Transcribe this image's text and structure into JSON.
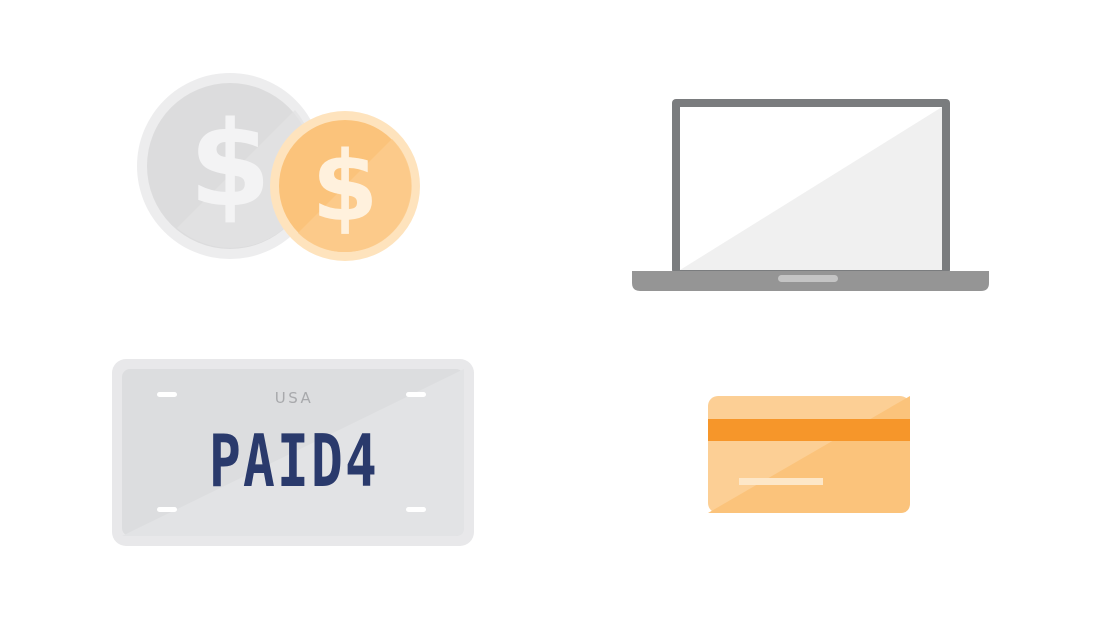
{
  "coins": {
    "silver_symbol": "$",
    "gold_symbol": "$"
  },
  "license_plate": {
    "country": "USA",
    "number": "PAID4"
  },
  "colors": {
    "silver_coin": "#dcdcdd",
    "silver_rim": "#ededee",
    "gold_coin": "#fbc37b",
    "gold_rim": "#fee3bd",
    "laptop_frame": "#7a7c7e",
    "laptop_screen": "#f0f0f0",
    "laptop_base": "#959595",
    "plate_body": "#dcdddf",
    "plate_rim": "#e8e8ea",
    "plate_text": "#2a3a6c",
    "card_body": "#fbc37b",
    "card_stripe": "#f6962a"
  }
}
